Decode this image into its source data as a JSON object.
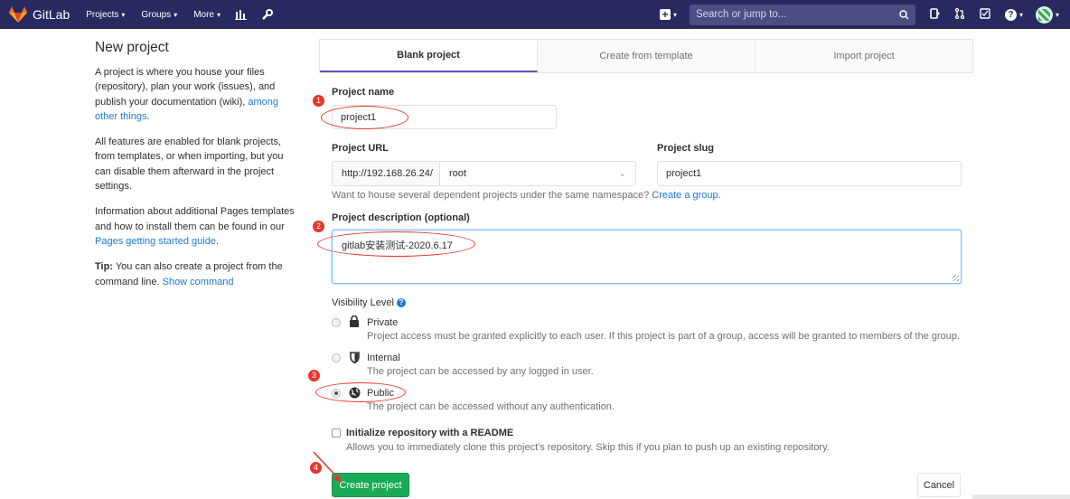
{
  "navbar": {
    "brand": "GitLab",
    "links": [
      "Projects",
      "Groups",
      "More"
    ],
    "search_placeholder": "Search or jump to..."
  },
  "info": {
    "title": "New project",
    "p1_text": "A project is where you house your files (repository), plan your work (issues), and publish your documentation (wiki),",
    "p1_link": "among other things",
    "p1_end": ".",
    "p2_text": "All features are enabled for blank projects, from templates, or when importing, but you can disable them afterward in the project settings.",
    "p3_text": "Information about additional Pages templates and how to install them can be found in our",
    "p3_link": "Pages getting started guide",
    "p3_end": ".",
    "tip_label": "Tip:",
    "tip_text": "You can also create a project from the command line.",
    "tip_link": "Show command"
  },
  "tabs": [
    "Blank project",
    "Create from template",
    "Import project"
  ],
  "form": {
    "project_name_label": "Project name",
    "project_name_value": "project1",
    "project_url_label": "Project URL",
    "url_prefix": "http://192.168.26.24/",
    "namespace_value": "root",
    "project_slug_label": "Project slug",
    "project_slug_value": "project1",
    "namespace_help": "Want to house several dependent projects under the same namespace?",
    "namespace_help_link": "Create a group.",
    "description_label": "Project description (optional)",
    "description_value": "gitlab安装测试-2020.6.17",
    "visibility_label": "Visibility Level",
    "visibility": [
      {
        "title": "Private",
        "icon": "lock-icon",
        "desc": "Project access must be granted explicitly to each user. If this project is part of a group, access will be granted to members of the group.",
        "checked": false
      },
      {
        "title": "Internal",
        "icon": "shield-icon",
        "desc": "The project can be accessed by any logged in user.",
        "checked": false
      },
      {
        "title": "Public",
        "icon": "globe-icon",
        "desc": "The project can be accessed without any authentication.",
        "checked": true
      }
    ],
    "readme_label": "Initialize repository with a README",
    "readme_desc": "Allows you to immediately clone this project's repository. Skip this if you plan to push up an existing repository.",
    "create_button": "Create project",
    "cancel_button": "Cancel"
  },
  "annotations": [
    "1",
    "2",
    "3",
    "4"
  ],
  "colors": {
    "navbar": "#292961",
    "active_tab_border": "#6b4fbb",
    "primary_button": "#1aaa55",
    "link": "#1f78d1",
    "annotation": "#e8352b"
  }
}
